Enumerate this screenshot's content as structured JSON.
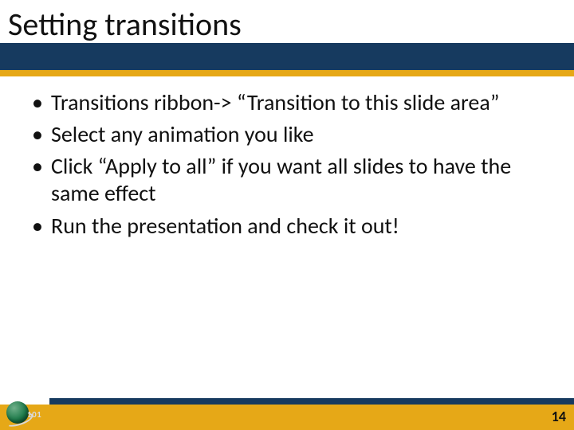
{
  "title": "Setting transitions",
  "bullets": [
    "Transitions ribbon-> “Transition to this slide area”",
    "Select any animation you like",
    "Click “Apply to all” if you want all slides to have the same effect",
    "Run the presentation and check it out!"
  ],
  "page_number": "14",
  "logo_text": "101",
  "colors": {
    "header_blue": "#163a5f",
    "accent_gold": "#e6a817"
  }
}
